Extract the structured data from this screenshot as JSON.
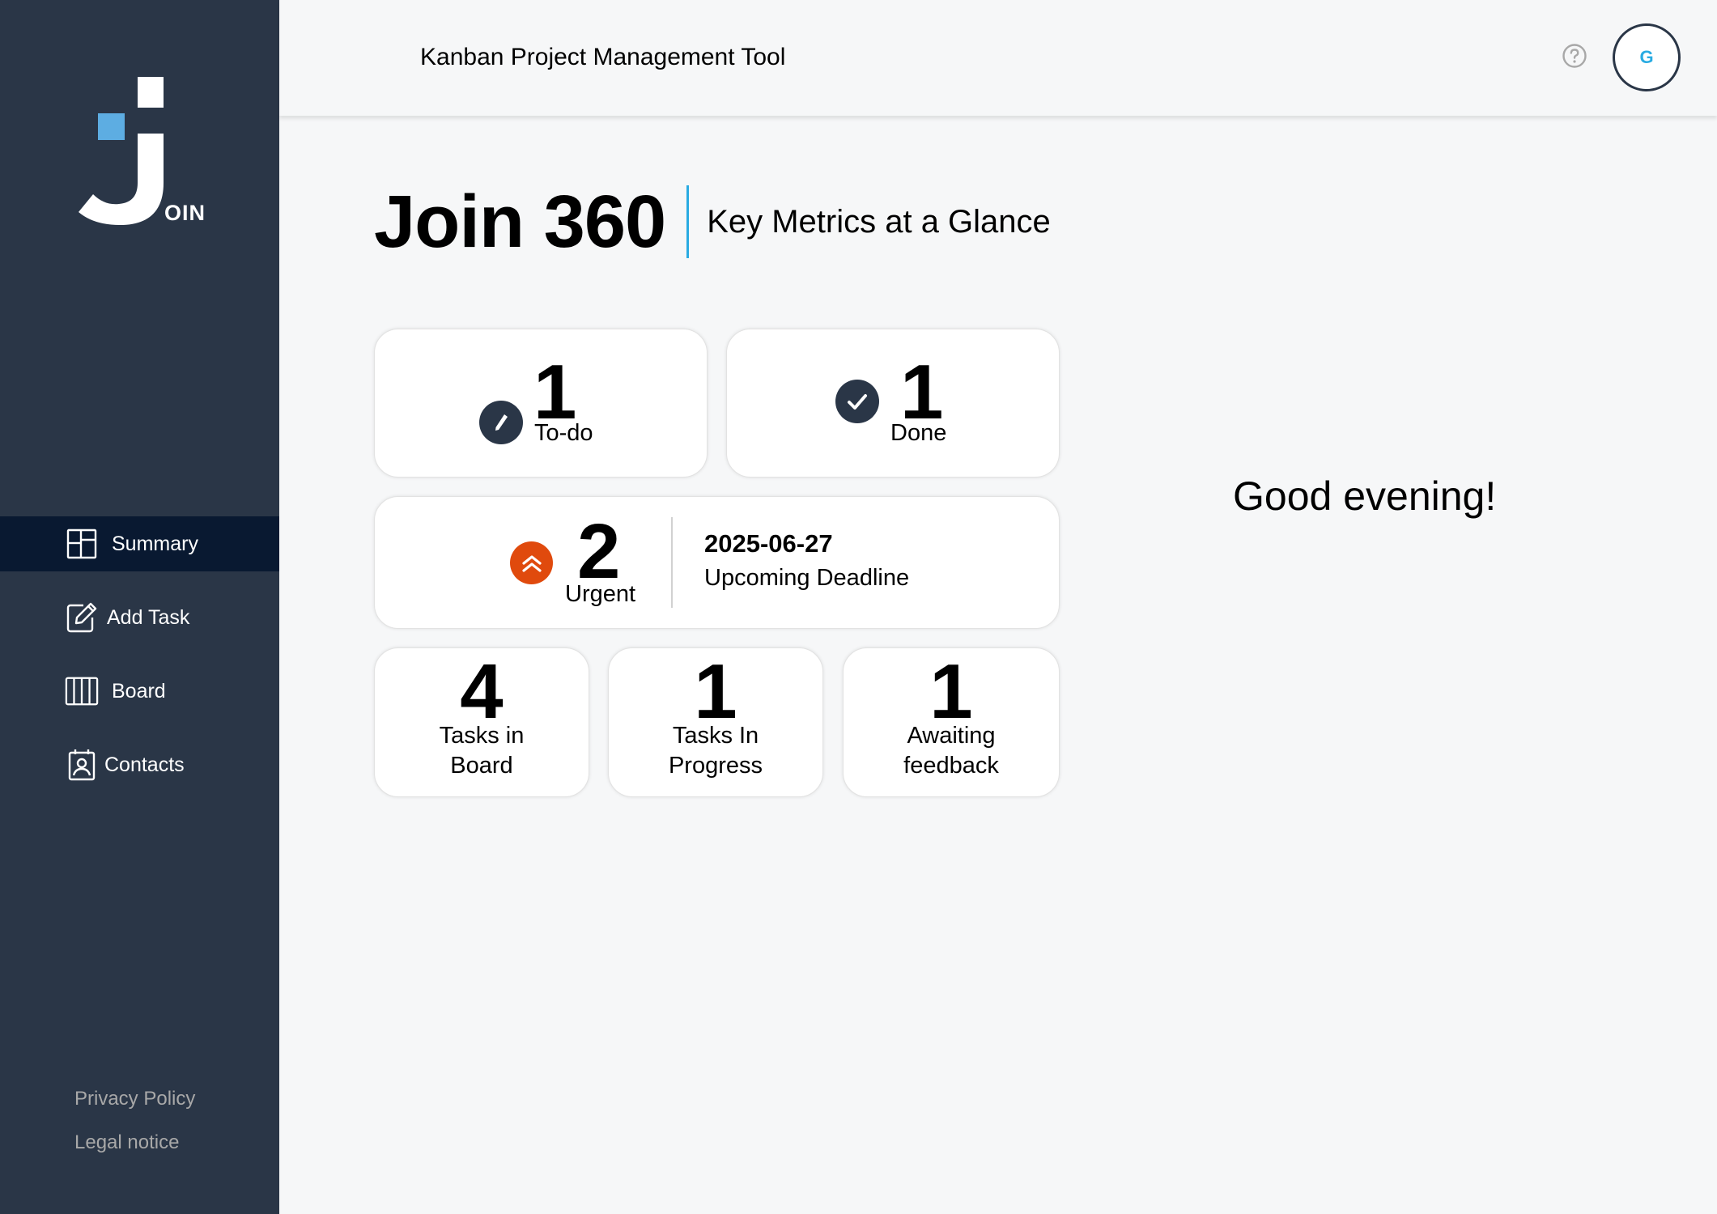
{
  "brand": {
    "logo_text": "OIN",
    "accent_color": "#29abe2"
  },
  "sidebar": {
    "items": [
      {
        "label": "Summary",
        "icon": "summary-icon",
        "active": true
      },
      {
        "label": "Add Task",
        "icon": "add-task-icon",
        "active": false
      },
      {
        "label": "Board",
        "icon": "board-icon",
        "active": false
      },
      {
        "label": "Contacts",
        "icon": "contacts-icon",
        "active": false
      }
    ],
    "footer_links": [
      "Privacy Policy",
      "Legal notice"
    ]
  },
  "header": {
    "title": "Kanban Project Management Tool",
    "help_icon": "help-icon",
    "avatar_initial": "G"
  },
  "main": {
    "title": "Join 360",
    "subtitle": "Key Metrics at a Glance",
    "todo": {
      "count": "1",
      "label": "To-do",
      "icon": "pencil-icon"
    },
    "done": {
      "count": "1",
      "label": "Done",
      "icon": "check-icon"
    },
    "urgent": {
      "count": "2",
      "label": "Urgent",
      "icon": "urgent-double-chevron-icon",
      "icon_color": "#e04a0d",
      "deadline_date": "2025-06-27",
      "deadline_label": "Upcoming Deadline"
    },
    "stats": [
      {
        "count": "4",
        "label_line1": "Tasks in",
        "label_line2": "Board"
      },
      {
        "count": "1",
        "label_line1": "Tasks In",
        "label_line2": "Progress"
      },
      {
        "count": "1",
        "label_line1": "Awaiting",
        "label_line2": "feedback"
      }
    ],
    "greeting": "Good evening!"
  }
}
